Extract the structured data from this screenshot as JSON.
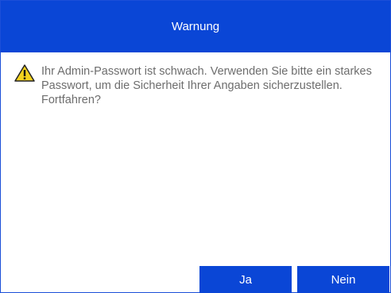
{
  "dialog": {
    "title": "Warnung",
    "icon": "warning-icon",
    "message": "Ihr Admin-Passwort ist schwach. Verwenden Sie bitte ein starkes Passwort, um die Sicherheit Ihrer Angaben sicherzustellen. Fortfahren?",
    "buttons": {
      "yes_label": "Ja",
      "no_label": "Nein"
    }
  },
  "colors": {
    "accent": "#0a46d6",
    "message_text": "#6d6d6d",
    "warning_fill": "#f4d21e"
  }
}
